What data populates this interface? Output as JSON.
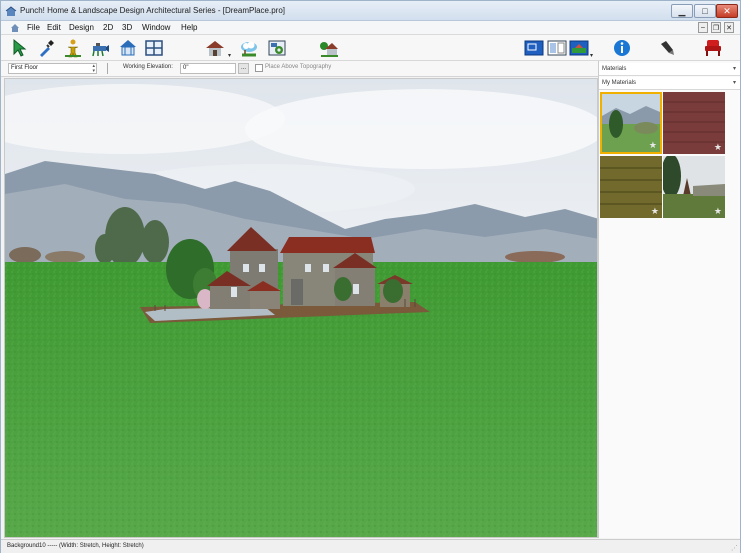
{
  "window": {
    "title": "Punch! Home & Landscape Design Architectural Series - [DreamPlace.pro]",
    "min_glyph": "▁",
    "max_glyph": "□",
    "close_glyph": "✕"
  },
  "menu": {
    "items": [
      "File",
      "Edit",
      "Design",
      "2D",
      "3D",
      "Window",
      "Help"
    ],
    "mdi_glyphs": [
      "–",
      "❐",
      "✕"
    ]
  },
  "toolbar": {
    "tools": [
      "select-arrow-icon",
      "eyedropper-icon",
      "person-icon",
      "watering-tool-icon",
      "gazebo-icon",
      "window-frame-icon",
      "house-icon",
      "landscape-cloud-icon",
      "settings-gear-icon",
      "house-tree-icon"
    ],
    "view_buttons": [
      "plan-view-icon",
      "split-view-icon",
      "3d-view-icon"
    ],
    "right_buttons": [
      "info-icon",
      "pen-icon",
      "chair-icon"
    ],
    "colors": {
      "info_blue": "#1a78d4",
      "chair_red": "#d01d1d"
    }
  },
  "subbar": {
    "floor_value": "First Floor",
    "elevation_label": "Working Elevation:",
    "elevation_value": "0\"",
    "elevation_button": "...",
    "topography_label": "Place Above Topography"
  },
  "right_panel": {
    "category_select": "Materials",
    "library_select": "My Materials",
    "caret": "▾",
    "swatches": [
      {
        "name": "landscape-photo",
        "favorite": "★"
      },
      {
        "name": "red-brick",
        "favorite": "★"
      },
      {
        "name": "wood-siding",
        "favorite": "★"
      },
      {
        "name": "yard-photo",
        "favorite": "★"
      }
    ],
    "selected_color": "#f0b000"
  },
  "status": {
    "text": "Background10 ----- (Width: Stretch, Height: Stretch)"
  },
  "scene": {
    "sky_color": "#e9edf1",
    "grass_color": "#4a9e3a"
  }
}
